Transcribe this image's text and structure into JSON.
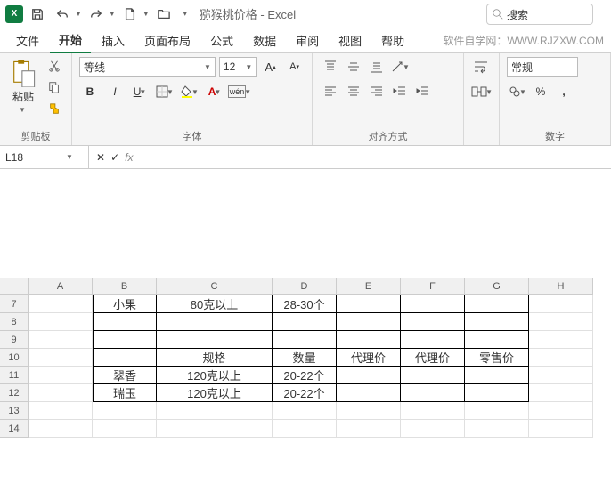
{
  "title": "猕猴桃价格 - Excel",
  "search_placeholder": "搜索",
  "tabs": {
    "file": "文件",
    "home": "开始",
    "insert": "插入",
    "layout": "页面布局",
    "formulas": "公式",
    "data": "数据",
    "review": "审阅",
    "view": "视图",
    "help": "帮助"
  },
  "watermark": "软件自学网：WWW.RJZXW.COM",
  "ribbon": {
    "paste_label": "粘贴",
    "clipboard_group": "剪贴板",
    "font_name": "等线",
    "font_size": "12",
    "font_group": "字体",
    "align_group": "对齐方式",
    "number_format": "常规",
    "number_group": "数字"
  },
  "namebox": "L18",
  "columns": [
    "A",
    "B",
    "C",
    "D",
    "E",
    "F",
    "G",
    "H"
  ],
  "rows": [
    "7",
    "8",
    "9",
    "10",
    "11",
    "12",
    "13",
    "14"
  ],
  "cells": {
    "r7": {
      "B": "小果",
      "C": "80克以上",
      "D": "28-30个"
    },
    "r10": {
      "C": "规格",
      "D": "数量",
      "E": "代理价",
      "F": "代理价",
      "G": "零售价"
    },
    "r11": {
      "B": "翠香",
      "C": "120克以上",
      "D": "20-22个"
    },
    "r12": {
      "B": "瑞玉",
      "C": "120克以上",
      "D": "20-22个"
    }
  },
  "chart_data": {
    "type": "table",
    "title": "猕猴桃价格",
    "sections": [
      {
        "rows": [
          {
            "品种": "小果",
            "规格": "80克以上",
            "数量": "28-30个"
          }
        ]
      },
      {
        "headers": [
          "",
          "规格",
          "数量",
          "代理价",
          "代理价",
          "零售价"
        ],
        "rows": [
          {
            "品种": "翠香",
            "规格": "120克以上",
            "数量": "20-22个",
            "代理价1": "",
            "代理价2": "",
            "零售价": ""
          },
          {
            "品种": "瑞玉",
            "规格": "120克以上",
            "数量": "20-22个",
            "代理价1": "",
            "代理价2": "",
            "零售价": ""
          }
        ]
      }
    ]
  }
}
